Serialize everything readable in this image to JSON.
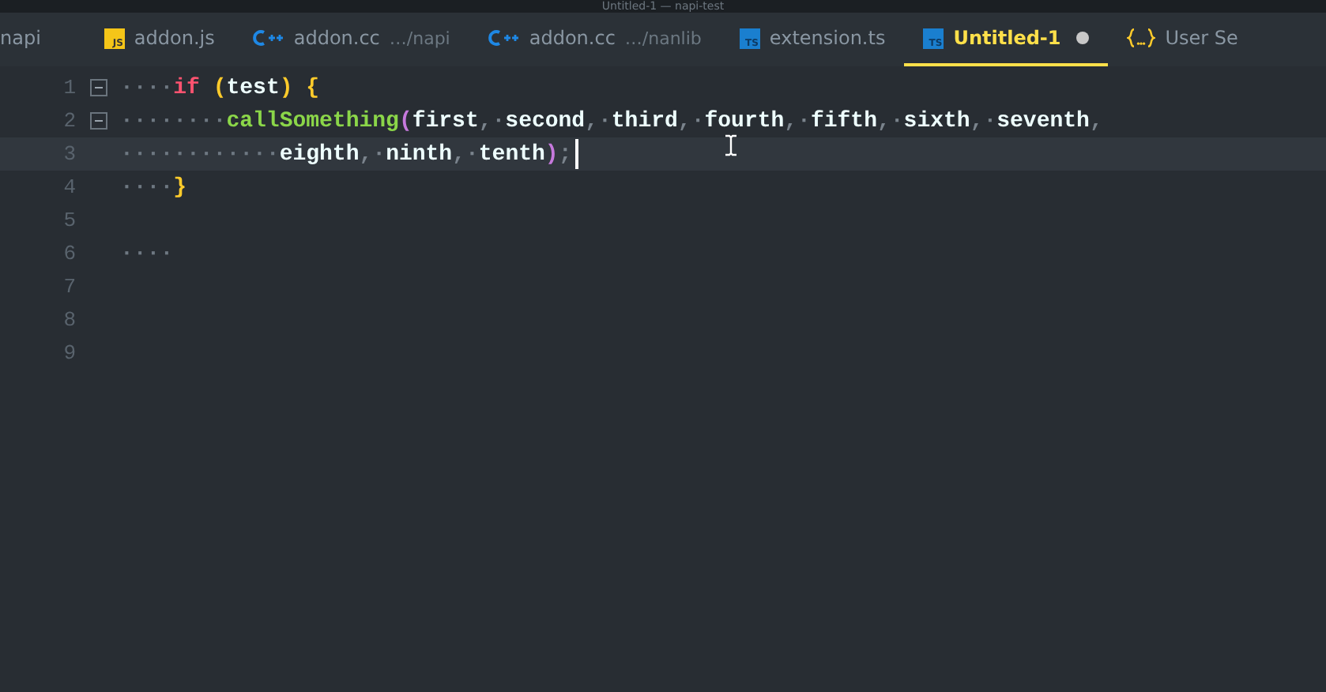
{
  "window": {
    "title": "Untitled-1 — napi-test"
  },
  "tabs": [
    {
      "kind": "plain",
      "label": "napi",
      "selected": false,
      "dirty": false
    },
    {
      "kind": "js",
      "icon_text": "JS",
      "label": "addon.js",
      "selected": false,
      "dirty": false
    },
    {
      "kind": "cpp",
      "label": "addon.cc",
      "detail": "…/napi",
      "selected": false,
      "dirty": false
    },
    {
      "kind": "cpp",
      "label": "addon.cc",
      "detail": "…/nanlib",
      "selected": false,
      "dirty": false
    },
    {
      "kind": "ts",
      "icon_text": "TS",
      "label": "extension.ts",
      "selected": false,
      "dirty": false
    },
    {
      "kind": "ts",
      "icon_text": "TS",
      "label": "Untitled-1",
      "selected": true,
      "dirty": true
    },
    {
      "kind": "settings",
      "label": "User Se",
      "selected": false,
      "dirty": false
    }
  ],
  "lines": [
    {
      "number": "1",
      "foldable": true,
      "current": false,
      "cursor": false,
      "tokens": [
        {
          "kind": "indent",
          "text": "····"
        },
        {
          "kind": "keyword",
          "text": "if "
        },
        {
          "kind": "paren",
          "text": "("
        },
        {
          "kind": "ident",
          "text": "test"
        },
        {
          "kind": "paren",
          "text": ") {"
        }
      ]
    },
    {
      "number": "2",
      "foldable": true,
      "current": false,
      "cursor": false,
      "tokens": [
        {
          "kind": "indent",
          "text": "········"
        },
        {
          "kind": "func",
          "text": "callSomething"
        },
        {
          "kind": "call",
          "text": "("
        },
        {
          "kind": "ident",
          "text": "first"
        },
        {
          "kind": "punct",
          "text": ",·"
        },
        {
          "kind": "ident",
          "text": "second"
        },
        {
          "kind": "punct",
          "text": ",·"
        },
        {
          "kind": "ident",
          "text": "third"
        },
        {
          "kind": "punct",
          "text": ",·"
        },
        {
          "kind": "ident",
          "text": "fourth"
        },
        {
          "kind": "punct",
          "text": ",·"
        },
        {
          "kind": "ident",
          "text": "fifth"
        },
        {
          "kind": "punct",
          "text": ",·"
        },
        {
          "kind": "ident",
          "text": "sixth"
        },
        {
          "kind": "punct",
          "text": ",·"
        },
        {
          "kind": "ident",
          "text": "seventh"
        },
        {
          "kind": "punct",
          "text": ","
        }
      ]
    },
    {
      "number": "3",
      "foldable": false,
      "current": true,
      "cursor": true,
      "tokens": [
        {
          "kind": "indent",
          "text": "············"
        },
        {
          "kind": "ident",
          "text": "eighth"
        },
        {
          "kind": "punct",
          "text": ",·"
        },
        {
          "kind": "ident",
          "text": "ninth"
        },
        {
          "kind": "punct",
          "text": ",·"
        },
        {
          "kind": "ident",
          "text": "tenth"
        },
        {
          "kind": "call",
          "text": ")"
        },
        {
          "kind": "punct",
          "text": ";"
        }
      ]
    },
    {
      "number": "4",
      "foldable": false,
      "current": false,
      "cursor": false,
      "tokens": [
        {
          "kind": "indent",
          "text": "····"
        },
        {
          "kind": "paren",
          "text": "}"
        }
      ]
    },
    {
      "number": "5",
      "foldable": false,
      "current": false,
      "cursor": false
    },
    {
      "number": "6",
      "foldable": false,
      "current": false,
      "cursor": false,
      "tokens": [
        {
          "kind": "indent",
          "text": "····"
        }
      ]
    },
    {
      "number": "7",
      "foldable": false,
      "current": false,
      "cursor": false
    },
    {
      "number": "8",
      "foldable": false,
      "current": false,
      "cursor": false
    },
    {
      "number": "9",
      "foldable": false,
      "current": false,
      "cursor": false
    }
  ]
}
